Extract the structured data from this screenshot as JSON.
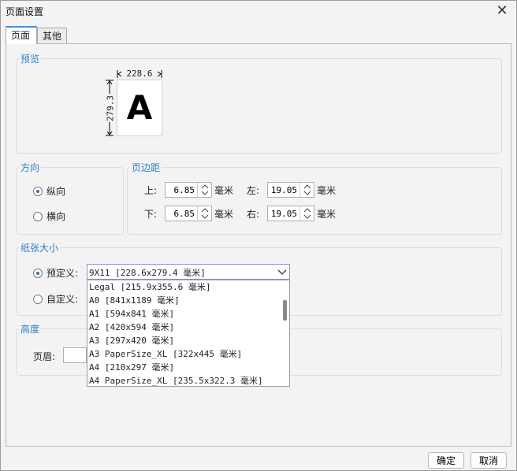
{
  "window": {
    "title": "页面设置"
  },
  "tabs": [
    {
      "label": "页面",
      "active": true
    },
    {
      "label": "其他",
      "active": false
    }
  ],
  "preview": {
    "title": "预览",
    "width_label": "228.6",
    "height_label": "279.3",
    "letter": "A"
  },
  "orientation": {
    "title": "方向",
    "options": [
      {
        "label": "纵向",
        "checked": true
      },
      {
        "label": "横向",
        "checked": false
      }
    ]
  },
  "margins": {
    "title": "页边距",
    "unit": "毫米",
    "top": {
      "label": "上:",
      "value": "6.85"
    },
    "left": {
      "label": "左:",
      "value": "19.05"
    },
    "bottom": {
      "label": "下:",
      "value": "6.85"
    },
    "right": {
      "label": "右:",
      "value": "19.05"
    }
  },
  "paper": {
    "title": "纸张大小",
    "predefined_label": "预定义:",
    "custom_label": "自定义:",
    "predefined_checked": true,
    "selected": "9X11 [228.6x279.4 毫米]",
    "options": [
      "Legal [215.9x355.6 毫米]",
      "A0 [841x1189 毫米]",
      "A1 [594x841 毫米]",
      "A2 [420x594 毫米]",
      "A3 [297x420 毫米]",
      "A3 PaperSize_XL [322x445 毫米]",
      "A4 [210x297 毫米]",
      "A4 PaperSize_XL [235.5x322.3 毫米]"
    ]
  },
  "height": {
    "title": "高度",
    "header_label": "页眉:"
  },
  "footer": {
    "ok_label": "确定",
    "cancel_label": "取消"
  },
  "colors": {
    "accent": "#2e7cc8",
    "tab_border": "#3c8fdd"
  }
}
